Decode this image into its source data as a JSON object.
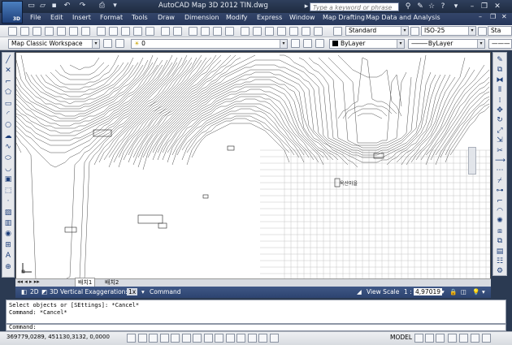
{
  "app": {
    "badge": "3D",
    "title": "AutoCAD Map 3D 2012    TIN.dwg",
    "search_placeholder": "Type a keyword or phrase"
  },
  "menu": [
    "File",
    "Edit",
    "Insert",
    "Format",
    "Tools",
    "Draw",
    "Dimension",
    "Modify",
    "Express",
    "Window",
    "Map Drafting",
    "Map Data and Analysis"
  ],
  "toolbar1": {
    "text_style": "Standard",
    "dim_style": "ISO-25",
    "table_style_partial": "Sta"
  },
  "toolbar2": {
    "workspace": "Map Classic Workspace",
    "layer": "0",
    "color": "ByLayer",
    "linetype": "ByLayer"
  },
  "tabs": [
    "배치1",
    "배치2"
  ],
  "map_status": {
    "view_2d": "2D",
    "view_3d": "3D",
    "vertical_exaggeration_label": "Vertical Exaggeration:",
    "vertical_exaggeration_value": "1x",
    "command_label": "Command",
    "view_scale_label": "View Scale",
    "view_scale_prefix": "1 :",
    "view_scale_value": "4,97019"
  },
  "command_history": [
    "Select objects or [SEttings]: *Cancel*",
    "Command: *Cancel*"
  ],
  "command_prompt": "Command:",
  "status": {
    "coordinates": "369779,0289, 451130,3132, 0,0000",
    "model_label": "MODEL"
  },
  "drawing_labels": [
    "옥산마을"
  ]
}
